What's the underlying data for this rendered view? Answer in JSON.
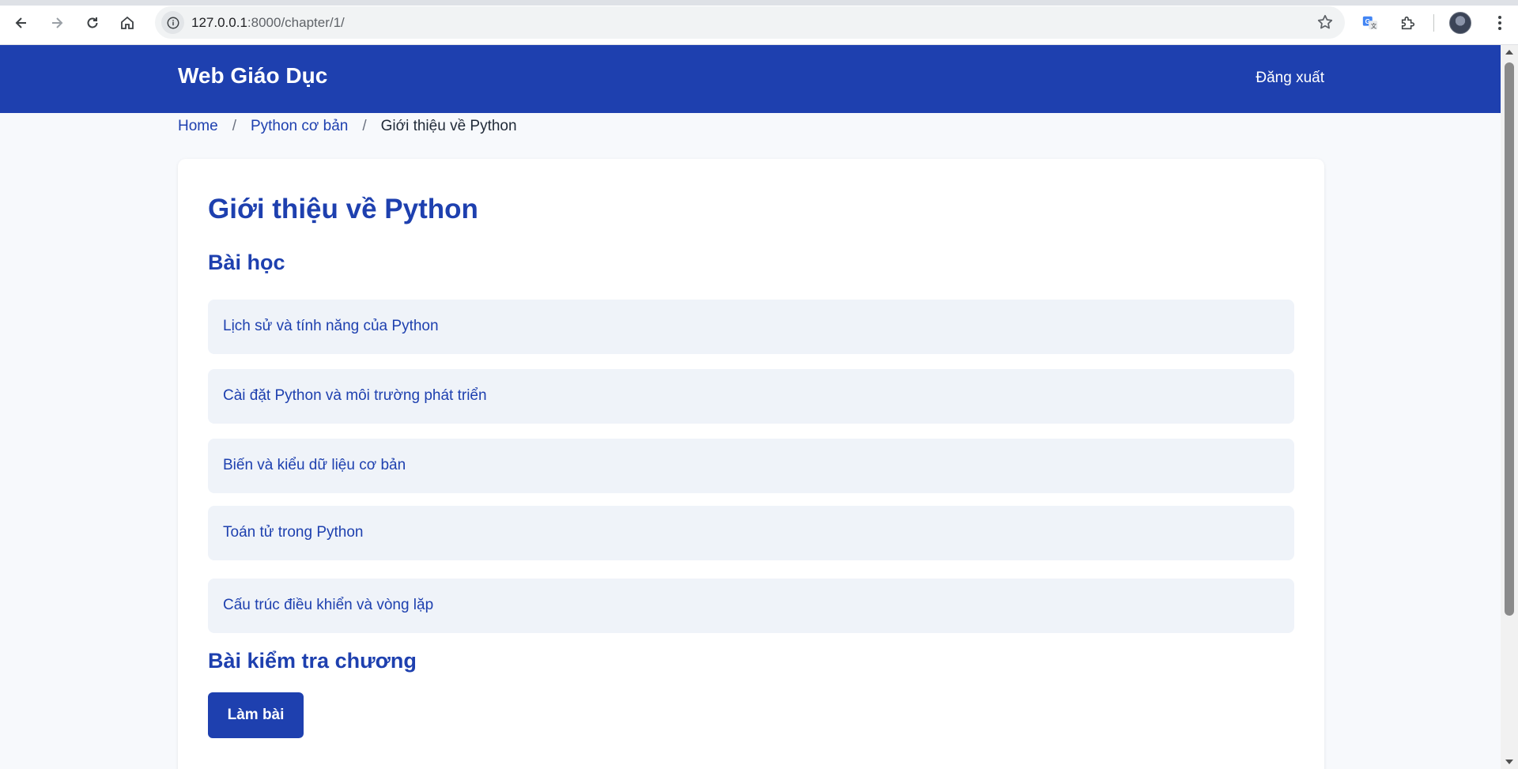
{
  "browser": {
    "url_host": "127.0.0.1",
    "url_rest": ":8000/chapter/1/"
  },
  "navbar": {
    "brand": "Web Giáo Dục",
    "logout_label": "Đăng xuất"
  },
  "breadcrumb": {
    "items": [
      "Home",
      "Python cơ bản"
    ],
    "current": "Giới thiệu về Python",
    "separator": "/"
  },
  "main": {
    "title": "Giới thiệu về Python",
    "lessons_heading": "Bài học",
    "lessons": [
      "Lịch sử và tính năng của Python",
      "Cài đặt Python và môi trường phát triển",
      "Biến và kiểu dữ liệu cơ bản",
      "Toán tử trong Python",
      "Cấu trúc điều khiển và vòng lặp"
    ],
    "quiz_heading": "Bài kiểm tra chương",
    "quiz_button": "Làm bài"
  },
  "colors": {
    "primary": "#1e40af",
    "lesson_bg": "#eff3f9",
    "page_bg": "#f7f9fc"
  }
}
